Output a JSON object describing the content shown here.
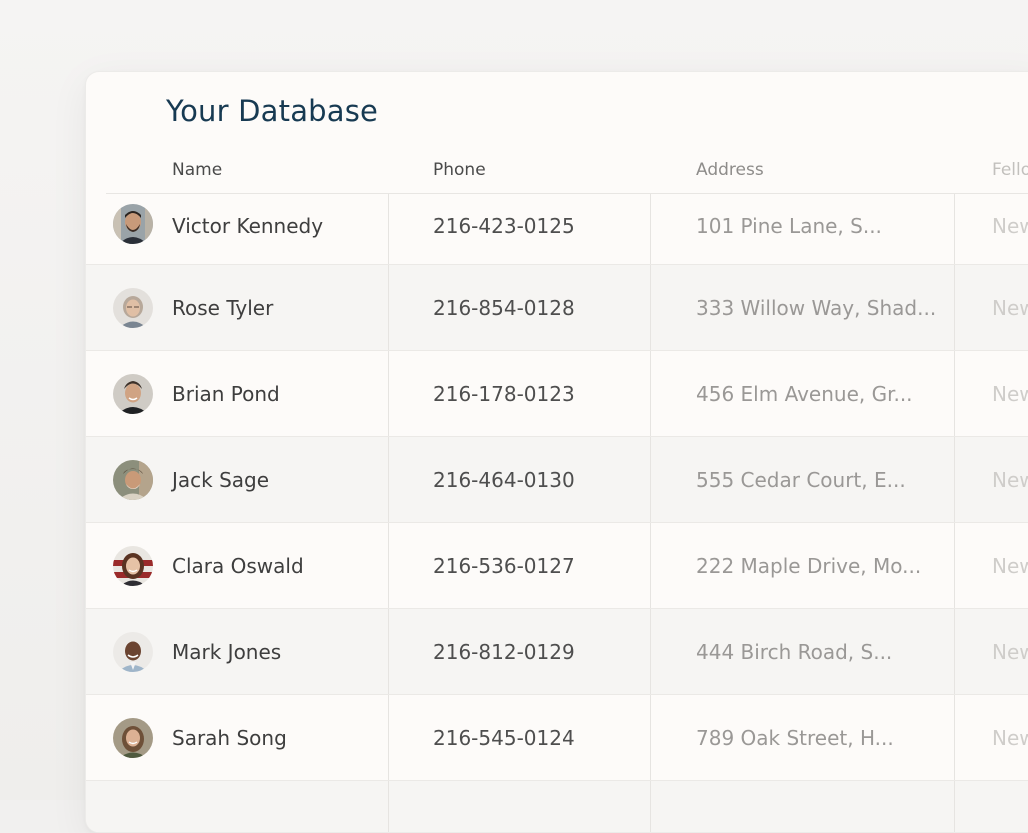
{
  "database": {
    "title": "Your Database",
    "columns": {
      "name": "Name",
      "phone": "Phone",
      "address": "Address",
      "fellow": "Fello"
    },
    "rows": [
      {
        "name": "Victor Kennedy",
        "phone": "216-423-0125",
        "address": "101 Pine Lane, S...",
        "fellow": "New",
        "avatar": "avatar-victor"
      },
      {
        "name": "Rose Tyler",
        "phone": "216-854-0128",
        "address": "333 Willow Way, Shad...",
        "fellow": "New",
        "avatar": "avatar-rose"
      },
      {
        "name": "Brian Pond",
        "phone": "216-178-0123",
        "address": "456 Elm Avenue, Gr...",
        "fellow": "New",
        "avatar": "avatar-brian"
      },
      {
        "name": "Jack Sage",
        "phone": "216-464-0130",
        "address": "555 Cedar Court, E...",
        "fellow": "New",
        "avatar": "avatar-jack"
      },
      {
        "name": "Clara Oswald",
        "phone": "216-536-0127",
        "address": "222 Maple Drive, Mo...",
        "fellow": "New",
        "avatar": "avatar-clara"
      },
      {
        "name": "Mark Jones",
        "phone": "216-812-0129",
        "address": "444 Birch Road, S...",
        "fellow": "New",
        "avatar": "avatar-mark"
      },
      {
        "name": "Sarah Song",
        "phone": "216-545-0124",
        "address": "789 Oak Street, H...",
        "fellow": "New",
        "avatar": "avatar-sarah"
      }
    ]
  },
  "colors": {
    "title": "#173a52",
    "card_bg": "#fdfbf9",
    "alt_row_bg": "#f6f5f3"
  }
}
